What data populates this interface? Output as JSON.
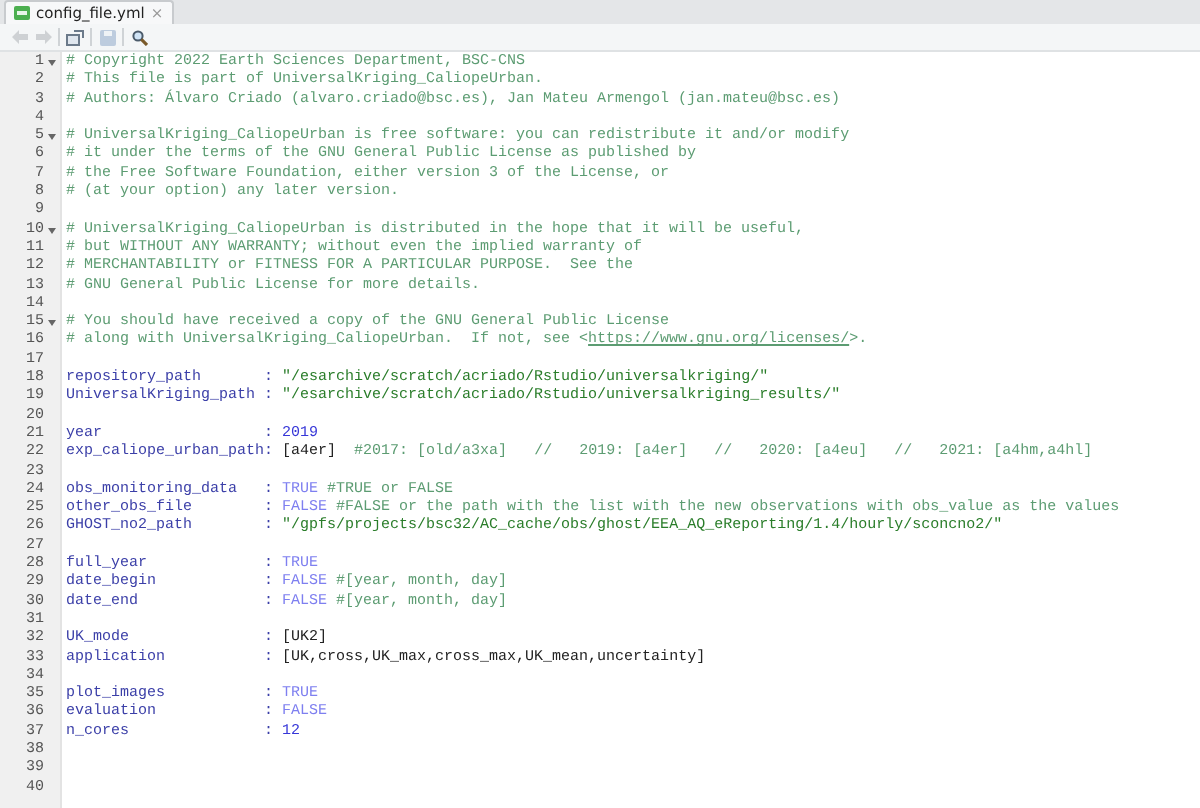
{
  "tabs": [
    {
      "label": "config_file.yml",
      "selected": true,
      "close": "×"
    }
  ],
  "toolbar": [
    {
      "kind": "back",
      "disabled": true
    },
    {
      "kind": "forward",
      "disabled": true
    },
    {
      "kind": "separator"
    },
    {
      "kind": "popout",
      "disabled": false
    },
    {
      "kind": "separator"
    },
    {
      "kind": "save",
      "disabled": true
    },
    {
      "kind": "separator"
    },
    {
      "kind": "search",
      "disabled": false
    }
  ],
  "lines": [
    {
      "number": "1",
      "foldable": true,
      "tokens": [
        {
          "kind": "comment",
          "text": "# Copyright 2022 Earth Sciences Department, BSC-CNS"
        }
      ]
    },
    {
      "number": "2",
      "tokens": [
        {
          "kind": "comment",
          "text": "# This file is part of UniversalKriging_CaliopeUrban."
        }
      ]
    },
    {
      "number": "3",
      "tokens": [
        {
          "kind": "comment",
          "text": "# Authors: Álvaro Criado (alvaro.criado@bsc.es), Jan Mateu Armengol (jan.mateu@bsc.es)"
        }
      ]
    },
    {
      "number": "4"
    },
    {
      "number": "5",
      "foldable": true,
      "tokens": [
        {
          "kind": "comment",
          "text": "# UniversalKriging_CaliopeUrban is free software: you can redistribute it and/or modify"
        }
      ]
    },
    {
      "number": "6",
      "tokens": [
        {
          "kind": "comment",
          "text": "# it under the terms of the GNU General Public License as published by"
        }
      ]
    },
    {
      "number": "7",
      "tokens": [
        {
          "kind": "comment",
          "text": "# the Free Software Foundation, either version 3 of the License, or"
        }
      ]
    },
    {
      "number": "8",
      "tokens": [
        {
          "kind": "comment",
          "text": "# (at your option) any later version."
        }
      ]
    },
    {
      "number": "9"
    },
    {
      "number": "10",
      "foldable": true,
      "tokens": [
        {
          "kind": "comment",
          "text": "# UniversalKriging_CaliopeUrban is distributed in the hope that it will be useful,"
        }
      ]
    },
    {
      "number": "11",
      "tokens": [
        {
          "kind": "comment",
          "text": "# but WITHOUT ANY WARRANTY; without even the implied warranty of"
        }
      ]
    },
    {
      "number": "12",
      "tokens": [
        {
          "kind": "comment",
          "text": "# MERCHANTABILITY or FITNESS FOR A PARTICULAR PURPOSE.  See the"
        }
      ]
    },
    {
      "number": "13",
      "tokens": [
        {
          "kind": "comment",
          "text": "# GNU General Public License for more details."
        }
      ]
    },
    {
      "number": "14"
    },
    {
      "number": "15",
      "foldable": true,
      "tokens": [
        {
          "kind": "comment",
          "text": "# You should have received a copy of the GNU General Public License"
        }
      ]
    },
    {
      "number": "16",
      "tokens": [
        {
          "kind": "comment",
          "text": "# along with UniversalKriging_CaliopeUrban.  If not, see <"
        },
        {
          "kind": "link",
          "text": "https://www.gnu.org/licenses/"
        },
        {
          "kind": "comment",
          "text": ">."
        }
      ]
    },
    {
      "number": "17"
    },
    {
      "number": "18",
      "tokens": [
        {
          "kind": "key",
          "text": "repository_path"
        },
        {
          "kind": "colon",
          "text": ":"
        },
        {
          "kind": "string",
          "text": "\"/esarchive/scratch/acriado/Rstudio/universalkriging/\""
        }
      ]
    },
    {
      "number": "19",
      "tokens": [
        {
          "kind": "key",
          "text": "UniversalKriging_path"
        },
        {
          "kind": "colon",
          "text": ":"
        },
        {
          "kind": "string",
          "text": "\"/esarchive/scratch/acriado/Rstudio/universalkriging_results/\""
        }
      ]
    },
    {
      "number": "20"
    },
    {
      "number": "21",
      "tokens": [
        {
          "kind": "key",
          "text": "year"
        },
        {
          "kind": "colon",
          "text": ":"
        },
        {
          "kind": "number",
          "text": "2019"
        }
      ]
    },
    {
      "number": "22",
      "tokens": [
        {
          "kind": "key",
          "text": "exp_caliope_urban_path"
        },
        {
          "kind": "colon",
          "text": ":"
        },
        {
          "kind": "plain",
          "text": "[a4er]"
        },
        {
          "kind": "comment",
          "text": "  #2017: [old/a3xa]   //   2019: [a4er]   //   2020: [a4eu]   //   2021: [a4hm,a4hl]"
        }
      ]
    },
    {
      "number": "23"
    },
    {
      "number": "24",
      "tokens": [
        {
          "kind": "key",
          "text": "obs_monitoring_data"
        },
        {
          "kind": "colon",
          "text": ":"
        },
        {
          "kind": "bool",
          "text": "TRUE"
        },
        {
          "kind": "comment",
          "text": " #TRUE or FALSE"
        }
      ]
    },
    {
      "number": "25",
      "tokens": [
        {
          "kind": "key",
          "text": "other_obs_file"
        },
        {
          "kind": "colon",
          "text": ":"
        },
        {
          "kind": "bool",
          "text": "FALSE"
        },
        {
          "kind": "comment",
          "text": " #FALSE or the path with the list with the new observations with obs_value as the values"
        }
      ]
    },
    {
      "number": "26",
      "tokens": [
        {
          "kind": "key",
          "text": "GHOST_no2_path"
        },
        {
          "kind": "colon",
          "text": ":"
        },
        {
          "kind": "string",
          "text": "\"/gpfs/projects/bsc32/AC_cache/obs/ghost/EEA_AQ_eReporting/1.4/hourly/sconcno2/\""
        }
      ]
    },
    {
      "number": "27"
    },
    {
      "number": "28",
      "tokens": [
        {
          "kind": "key",
          "text": "full_year"
        },
        {
          "kind": "colon",
          "text": ":"
        },
        {
          "kind": "bool",
          "text": "TRUE"
        }
      ]
    },
    {
      "number": "29",
      "tokens": [
        {
          "kind": "key",
          "text": "date_begin"
        },
        {
          "kind": "colon",
          "text": ":"
        },
        {
          "kind": "bool",
          "text": "FALSE"
        },
        {
          "kind": "comment",
          "text": " #[year, month, day]"
        }
      ]
    },
    {
      "number": "30",
      "tokens": [
        {
          "kind": "key",
          "text": "date_end"
        },
        {
          "kind": "colon",
          "text": ":"
        },
        {
          "kind": "bool",
          "text": "FALSE"
        },
        {
          "kind": "comment",
          "text": " #[year, month, day]"
        }
      ]
    },
    {
      "number": "31"
    },
    {
      "number": "32",
      "tokens": [
        {
          "kind": "key",
          "text": "UK_mode"
        },
        {
          "kind": "colon",
          "text": ":"
        },
        {
          "kind": "plain",
          "text": "[UK2]"
        }
      ]
    },
    {
      "number": "33",
      "tokens": [
        {
          "kind": "key",
          "text": "application"
        },
        {
          "kind": "colon",
          "text": ":"
        },
        {
          "kind": "plain",
          "text": "[UK,cross,UK_max,cross_max,UK_mean,uncertainty]"
        }
      ]
    },
    {
      "number": "34"
    },
    {
      "number": "35",
      "tokens": [
        {
          "kind": "key",
          "text": "plot_images"
        },
        {
          "kind": "colon",
          "text": ":"
        },
        {
          "kind": "bool",
          "text": "TRUE"
        }
      ]
    },
    {
      "number": "36",
      "tokens": [
        {
          "kind": "key",
          "text": "evaluation"
        },
        {
          "kind": "colon",
          "text": ":"
        },
        {
          "kind": "bool",
          "text": "FALSE"
        }
      ]
    },
    {
      "number": "37",
      "tokens": [
        {
          "kind": "key",
          "text": "n_cores"
        },
        {
          "kind": "colon",
          "text": ":"
        },
        {
          "kind": "number",
          "text": "12"
        }
      ]
    },
    {
      "number": "38"
    },
    {
      "number": "39"
    },
    {
      "number": "40"
    }
  ]
}
